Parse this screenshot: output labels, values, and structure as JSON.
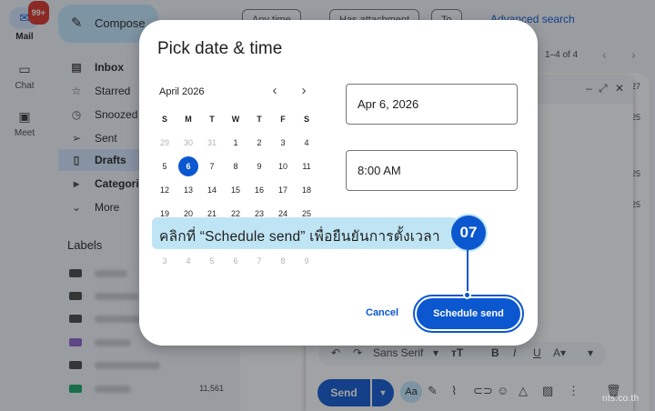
{
  "rail": {
    "badge": "99+",
    "items": [
      {
        "label": "Mail",
        "icon": "mail-icon"
      },
      {
        "label": "Chat",
        "icon": "chat-icon"
      },
      {
        "label": "Meet",
        "icon": "video-icon"
      }
    ]
  },
  "sidebar": {
    "compose_label": "Compose",
    "items": [
      {
        "label": "Inbox",
        "icon": "inbox-icon"
      },
      {
        "label": "Starred",
        "icon": "star-icon"
      },
      {
        "label": "Snoozed",
        "icon": "clock-icon"
      },
      {
        "label": "Sent",
        "icon": "send-icon"
      },
      {
        "label": "Drafts",
        "icon": "draft-icon"
      },
      {
        "label": "Categories",
        "icon": "label-icon"
      },
      {
        "label": "More",
        "icon": "chevron-down-icon"
      }
    ],
    "labels_heading": "Labels",
    "label_last_count": "11,561"
  },
  "toolbar": {
    "filters": [
      "Any time",
      "Has attachment",
      "To"
    ],
    "advanced_search": "Advanced search",
    "pager": "1–4 of 4",
    "row_dates": [
      "27",
      "25",
      "25",
      "25"
    ]
  },
  "compose_window": {
    "font_name": "Sans Serif",
    "send_label": "Send",
    "aa_label": "Aa"
  },
  "dialog": {
    "title": "Pick date & time",
    "month_label": "April 2026",
    "weekdays": [
      "S",
      "M",
      "T",
      "W",
      "T",
      "F",
      "S"
    ],
    "weeks": [
      [
        "29",
        "30",
        "31",
        "1",
        "2",
        "3",
        "4"
      ],
      [
        "5",
        "6",
        "7",
        "8",
        "9",
        "10",
        "11"
      ],
      [
        "12",
        "13",
        "14",
        "15",
        "16",
        "17",
        "18"
      ],
      [
        "19",
        "20",
        "21",
        "22",
        "23",
        "24",
        "25"
      ],
      [
        "26",
        "27",
        "28",
        "29",
        "30",
        "1",
        "2"
      ],
      [
        "3",
        "4",
        "5",
        "6",
        "7",
        "8",
        "9"
      ]
    ],
    "selected_day": "6",
    "date_value": "Apr 6, 2026",
    "time_value": "8:00 AM",
    "cancel_label": "Cancel",
    "schedule_label": "Schedule send"
  },
  "callout": {
    "text": "คลิกที่ “Schedule send” เพื่อยืนยันการตั้งเวลา",
    "step": "07"
  },
  "watermark": "nts.co.th",
  "colors": {
    "accent": "#0b57d0",
    "callout_bg": "#bfe5f5",
    "badge": "#d93025"
  }
}
